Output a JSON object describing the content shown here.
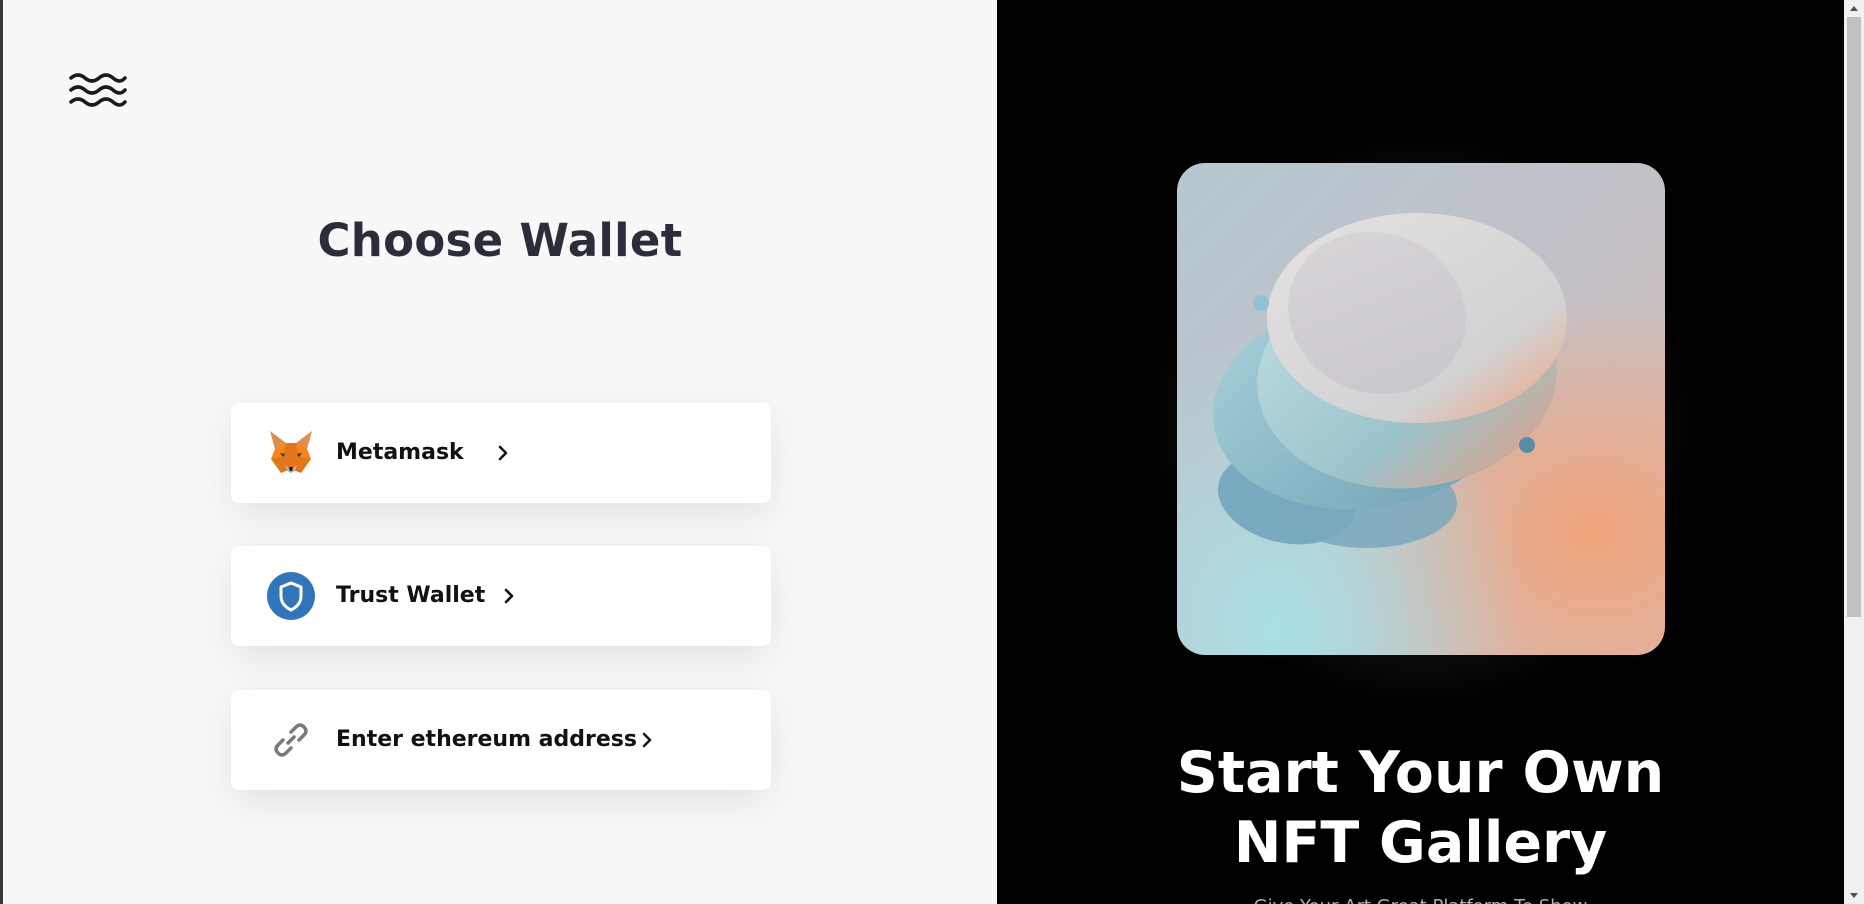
{
  "left": {
    "logo_icon": "waves-icon",
    "heading": "Choose Wallet",
    "wallets": [
      {
        "label": "Metamask",
        "icon": "metamask-fox-icon"
      },
      {
        "label": "Trust Wallet",
        "icon": "trust-wallet-shield-icon"
      },
      {
        "label": "Enter ethereum address",
        "icon": "link-icon"
      }
    ]
  },
  "right": {
    "hero_title_line1": "Start Your Own",
    "hero_title_line2": "NFT Gallery",
    "hero_subtitle": "Give Your Art Great Platform To Show"
  },
  "colors": {
    "left_bg": "#f8f8f8",
    "right_bg": "#000000",
    "heading": "#2b2d3a",
    "trust_blue": "#3375bb",
    "metamask_orange": "#e2761b"
  }
}
